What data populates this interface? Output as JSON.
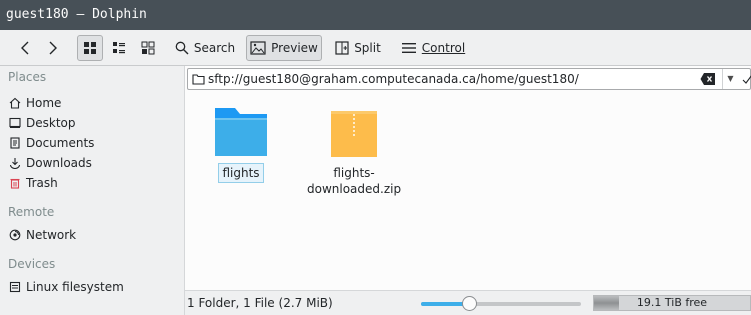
{
  "window": {
    "title": "guest180 — Dolphin"
  },
  "toolbar": {
    "back_icon": "chevron-left-icon",
    "forward_icon": "chevron-right-icon",
    "icons_view_icon": "view-icons-icon",
    "compact_view_icon": "view-compact-icon",
    "details_view_icon": "view-details-icon",
    "search_label": "Search",
    "preview_label": "Preview",
    "split_label": "Split",
    "control_label": "Control"
  },
  "sidebar": {
    "places_heading": "Places",
    "places": [
      {
        "label": "Home",
        "icon": "home-icon"
      },
      {
        "label": "Desktop",
        "icon": "desktop-icon"
      },
      {
        "label": "Documents",
        "icon": "documents-icon"
      },
      {
        "label": "Downloads",
        "icon": "downloads-icon"
      },
      {
        "label": "Trash",
        "icon": "trash-icon"
      }
    ],
    "remote_heading": "Remote",
    "remote": [
      {
        "label": "Network",
        "icon": "network-icon"
      }
    ],
    "devices_heading": "Devices",
    "devices": [
      {
        "label": "Linux filesystem",
        "icon": "drive-icon"
      }
    ]
  },
  "location": {
    "url": "sftp://guest180@graham.computecanada.ca/home/guest180/"
  },
  "files": [
    {
      "name": "flights",
      "type": "folder",
      "selected": true
    },
    {
      "name_line1": "flights-",
      "name_line2": "downloaded.zip",
      "type": "zip",
      "selected": false
    }
  ],
  "status": {
    "summary": "1 Folder, 1 File (2.7 MiB)",
    "zoom_fraction": 0.3,
    "free_space": "19.1 TiB free",
    "used_fraction": 0.16
  },
  "colors": {
    "titlebar": "#475057",
    "folder": "#3daee9",
    "zip": "#fdbc4b",
    "selection": "#93cee9"
  }
}
